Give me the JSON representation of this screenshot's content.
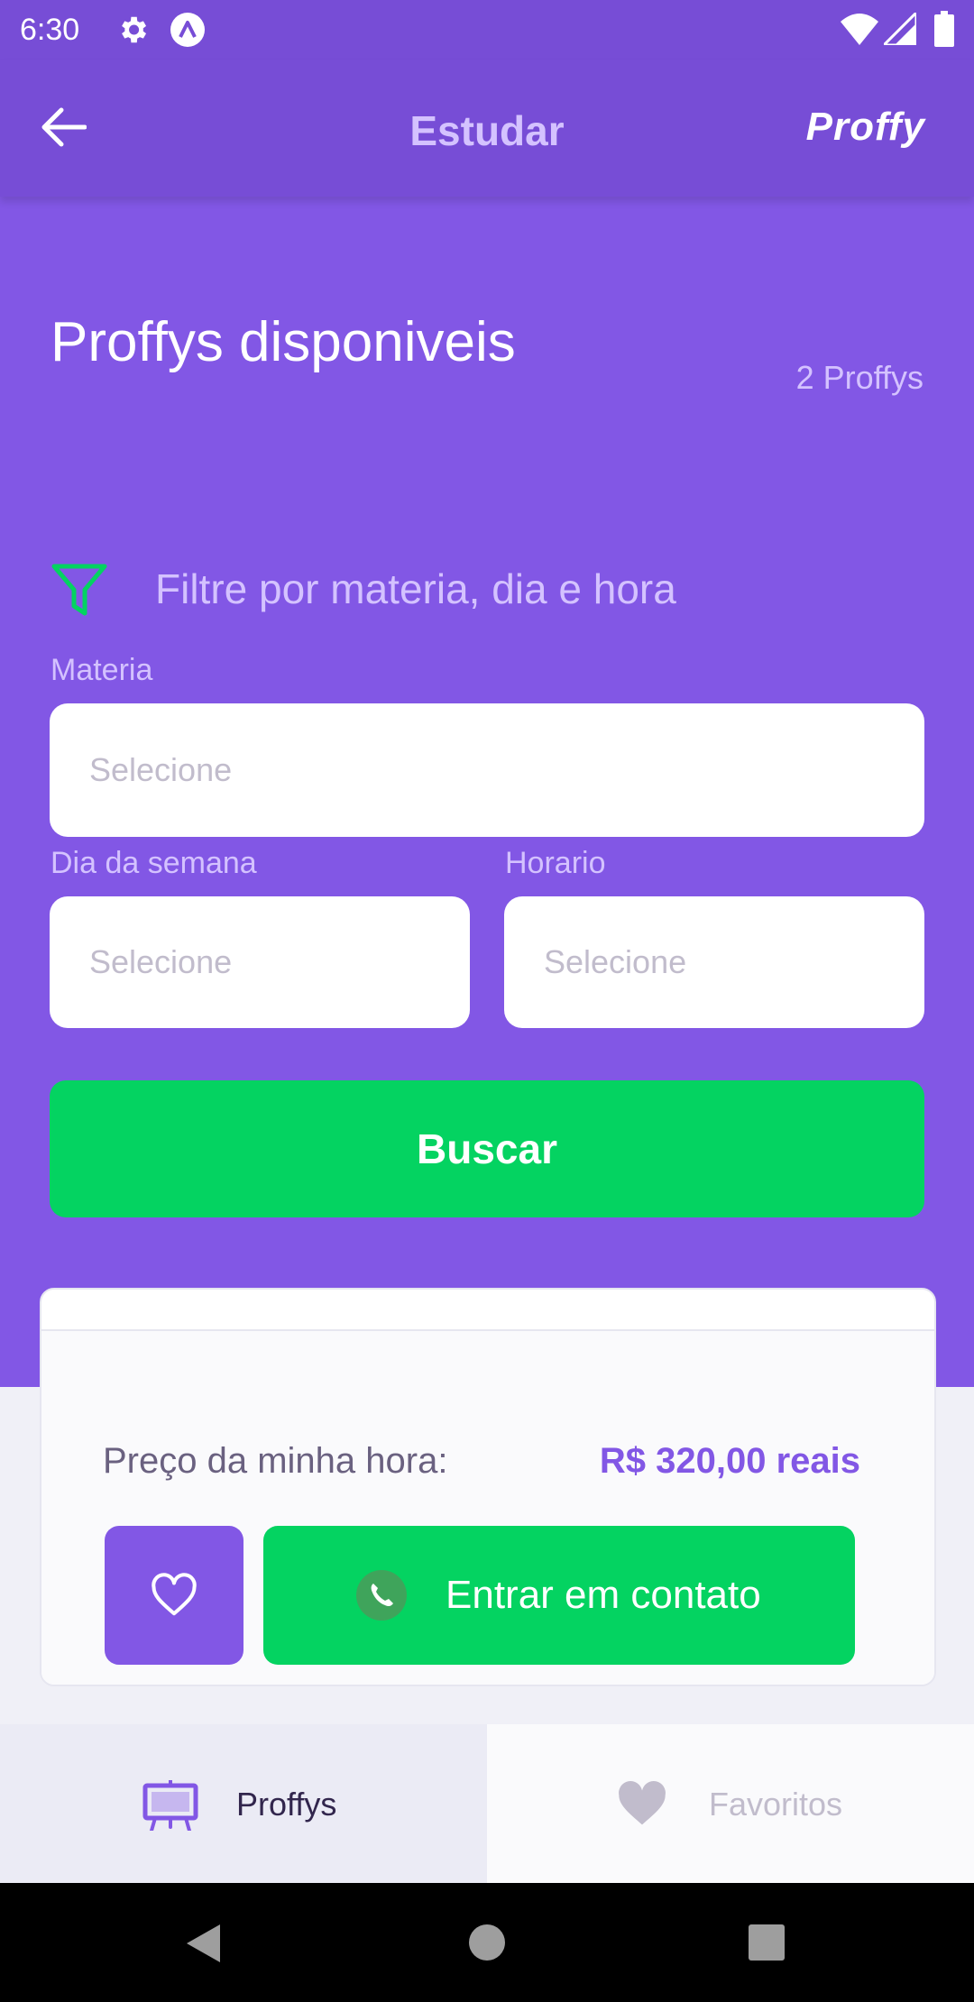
{
  "status_bar": {
    "time": "6:30"
  },
  "header": {
    "title": "Estudar",
    "brand": "Proffy"
  },
  "hero": {
    "heading": "Proffys disponiveis",
    "count": "2 Proffys",
    "filter_label": "Filtre por materia, dia e hora"
  },
  "filters": {
    "subject": {
      "label": "Materia",
      "placeholder": "Selecione"
    },
    "weekday": {
      "label": "Dia da semana",
      "placeholder": "Selecione"
    },
    "time": {
      "label": "Horario",
      "placeholder": "Selecione"
    },
    "search_button": "Buscar"
  },
  "card": {
    "price_label": "Preço da minha hora:",
    "price_value": "R$ 320,00 reais",
    "contact_button": "Entrar em contato"
  },
  "tabs": [
    {
      "label": "Proffys",
      "icon": "easel-icon",
      "active": true
    },
    {
      "label": "Favoritos",
      "icon": "heart-icon",
      "active": false
    }
  ],
  "colors": {
    "primary": "#8257E5",
    "primary_dark": "#774DD6",
    "accent_green": "#04D361",
    "text_light": "#D4C2FF"
  }
}
